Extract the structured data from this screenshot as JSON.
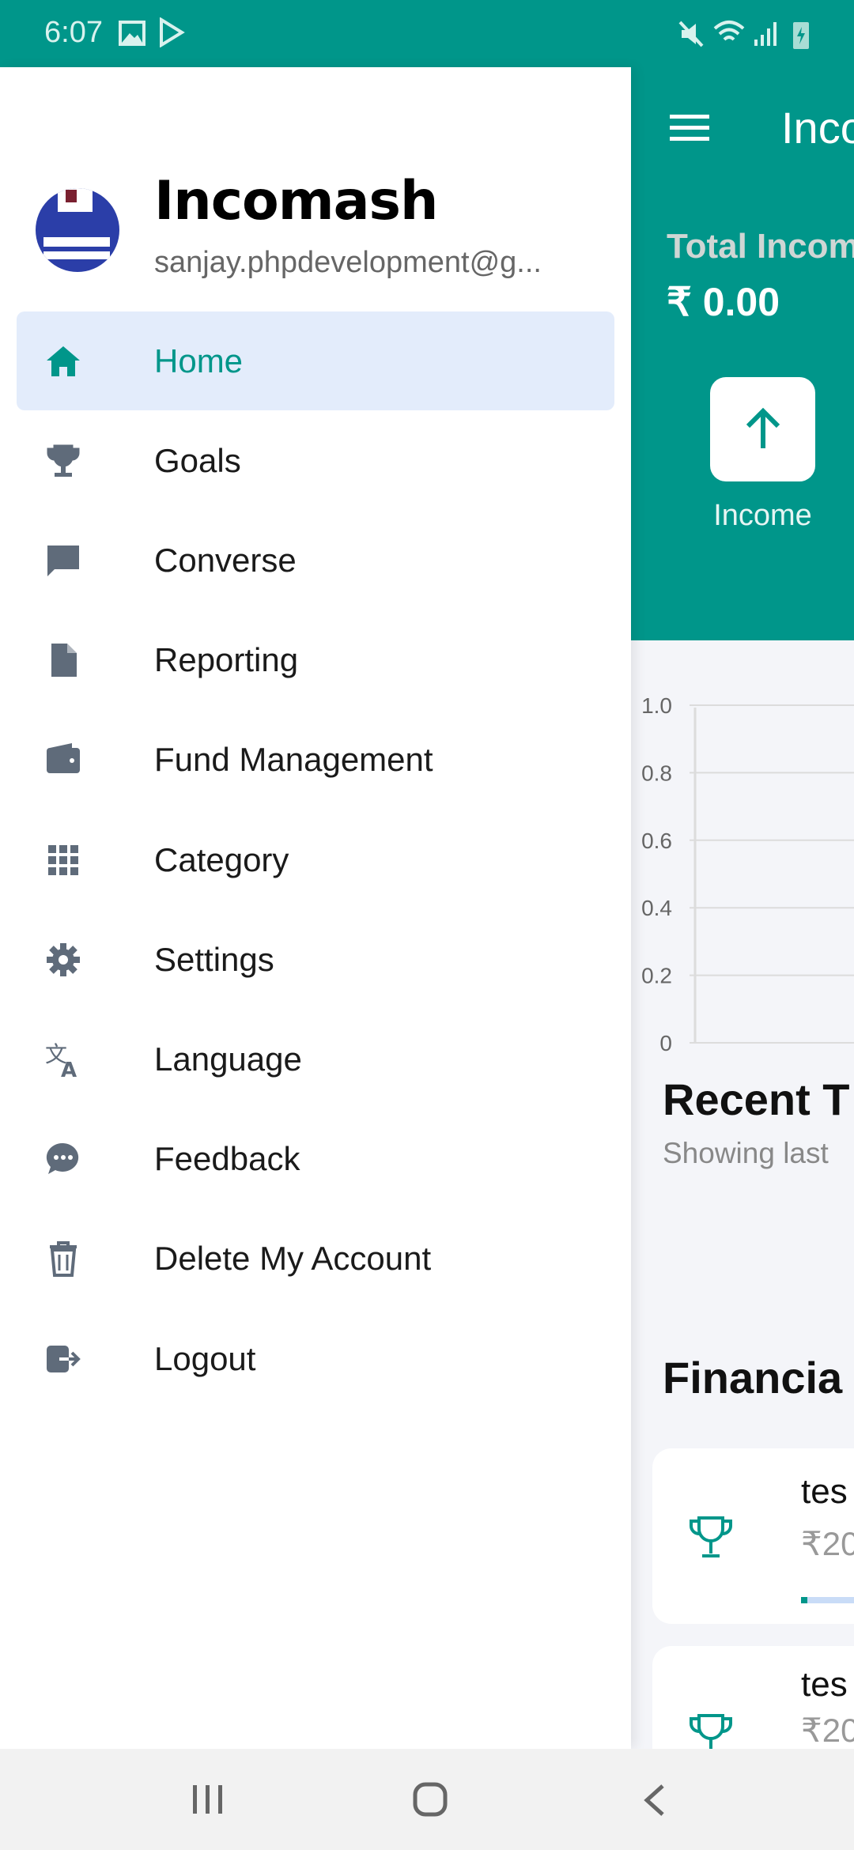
{
  "status_bar": {
    "time": "6:07",
    "icons": [
      "gallery-icon",
      "play-store-icon",
      "mute-icon",
      "wifi-icon",
      "signal-icon",
      "battery-charging-icon"
    ]
  },
  "drawer": {
    "app_name": "Incomash",
    "email": "sanjay.phpdevelopment@g...",
    "items": [
      {
        "label": "Home",
        "icon": "home-icon",
        "active": true
      },
      {
        "label": "Goals",
        "icon": "trophy-icon"
      },
      {
        "label": "Converse",
        "icon": "chat-icon"
      },
      {
        "label": "Reporting",
        "icon": "document-icon"
      },
      {
        "label": "Fund Management",
        "icon": "wallet-icon"
      },
      {
        "label": "Category",
        "icon": "grid-icon"
      },
      {
        "label": "Settings",
        "icon": "gear-icon"
      },
      {
        "label": "Language",
        "icon": "translate-icon"
      },
      {
        "label": "Feedback",
        "icon": "feedback-icon"
      },
      {
        "label": "Delete My Account",
        "icon": "trash-icon"
      },
      {
        "label": "Logout",
        "icon": "logout-icon"
      }
    ]
  },
  "main": {
    "title": "Inco",
    "total_label": "Total Incom",
    "total_value": "₹ 0.00",
    "income_button": "Income",
    "recent_title": "Recent T",
    "recent_sub": "Showing last",
    "financial_title": "Financia",
    "goals": [
      {
        "name": "tes",
        "amount": "₹20"
      },
      {
        "name": "tes",
        "amount": "₹20"
      }
    ]
  },
  "chart_data": {
    "type": "line",
    "yticks": [
      "1.0",
      "0.8",
      "0.6",
      "0.4",
      "0.2",
      "0"
    ],
    "ylim": [
      0,
      1
    ],
    "grid": true
  },
  "colors": {
    "primary": "#00968a",
    "active_bg": "#e3ecfb",
    "icon": "#5f6b7a"
  }
}
